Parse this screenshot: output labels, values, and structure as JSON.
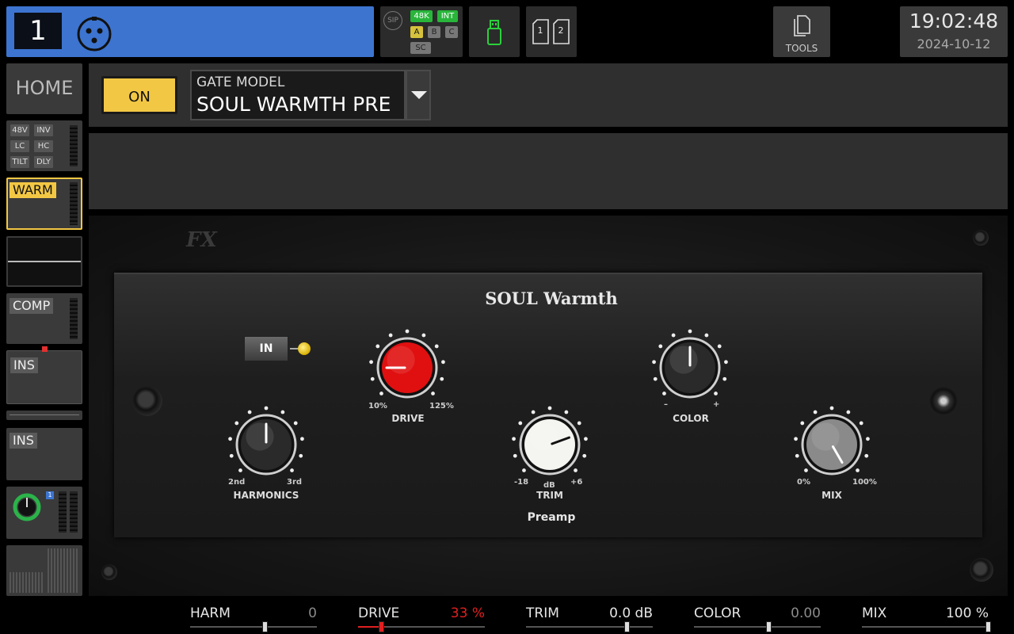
{
  "channel": {
    "number": "1"
  },
  "status": {
    "sip": "SIP",
    "rate": "48K",
    "clock": "INT",
    "a": "A",
    "b": "B",
    "c": "C",
    "sc": "SC"
  },
  "cards": {
    "card1": "1",
    "card2": "2"
  },
  "tools": {
    "label": "TOOLS"
  },
  "clock": {
    "time": "19:02:48",
    "date": "2024-10-12"
  },
  "sidebar": {
    "home": "HOME",
    "input_opts": [
      "48V",
      "INV",
      "LC",
      "HC",
      "TILT",
      "DLY"
    ],
    "warm": "WARM",
    "comp": "COMP",
    "ins1": "INS",
    "ins2": "INS",
    "send_badge": "1"
  },
  "header": {
    "on_label": "ON",
    "model_label": "GATE MODEL",
    "model_value": "SOUL WARMTH PRE"
  },
  "plugin": {
    "logo": "FX",
    "title": "SOUL Warmth",
    "in_label": "IN",
    "section": "Preamp",
    "knobs": {
      "harmonics": {
        "label": "HARMONICS",
        "min": "2nd",
        "max": "3rd"
      },
      "drive": {
        "label": "DRIVE",
        "min": "10%",
        "max": "125%"
      },
      "trim": {
        "label": "TRIM",
        "min": "-18",
        "max": "+6",
        "unit": "dB"
      },
      "color": {
        "label": "COLOR",
        "min": "–",
        "max": "+"
      },
      "mix": {
        "label": "MIX",
        "min": "0%",
        "max": "100%"
      }
    }
  },
  "params": [
    {
      "name": "HARM",
      "value": "0",
      "value_color": "#8a8a8a",
      "position": 0.5
    },
    {
      "name": "DRIVE",
      "value": "33 %",
      "value_color": "#e02020",
      "position": 0.0
    },
    {
      "name": "TRIM",
      "value": "0.0 dB",
      "value_color": "#e6e6e6",
      "position": 0.75
    },
    {
      "name": "COLOR",
      "value": "0.00",
      "value_color": "#8a8a8a",
      "position": 0.5
    },
    {
      "name": "MIX",
      "value": "100 %",
      "value_color": "#e6e6e6",
      "position": 1.0
    }
  ],
  "colors": {
    "accent": "#f2c744",
    "channel_blue": "#3c74d0",
    "drive_red": "#e01010"
  }
}
